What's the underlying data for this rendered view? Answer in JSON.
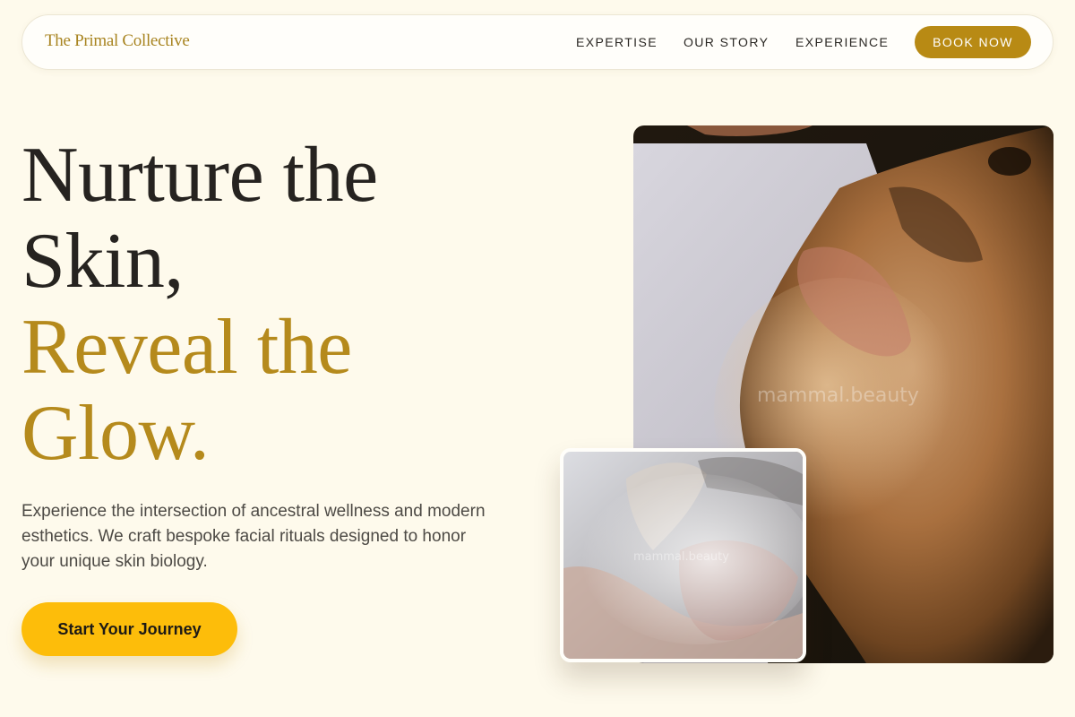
{
  "brand": {
    "logo": "The Primal Collective"
  },
  "nav": {
    "links": [
      "EXPERTISE",
      "OUR STORY",
      "EXPERIENCE"
    ],
    "cta": "BOOK NOW"
  },
  "hero": {
    "headline_line1": "Nurture the",
    "headline_line2": "Skin,",
    "headline_line3": "Reveal the",
    "headline_line4": "Glow.",
    "intro": "Experience the intersection of ancestral wellness and modern esthetics. We craft bespoke facial rituals designed to honor your unique skin biology.",
    "cta": "Start Your Journey"
  },
  "images": {
    "main_watermark": "mammal.beauty",
    "inset_watermark": "mammal.beauty"
  },
  "colors": {
    "page_bg": "#fefaec",
    "accent_gold": "#b58a1c",
    "book_button": "#b88a14",
    "cta_button": "#fdbd0a",
    "text_dark": "#262320"
  }
}
